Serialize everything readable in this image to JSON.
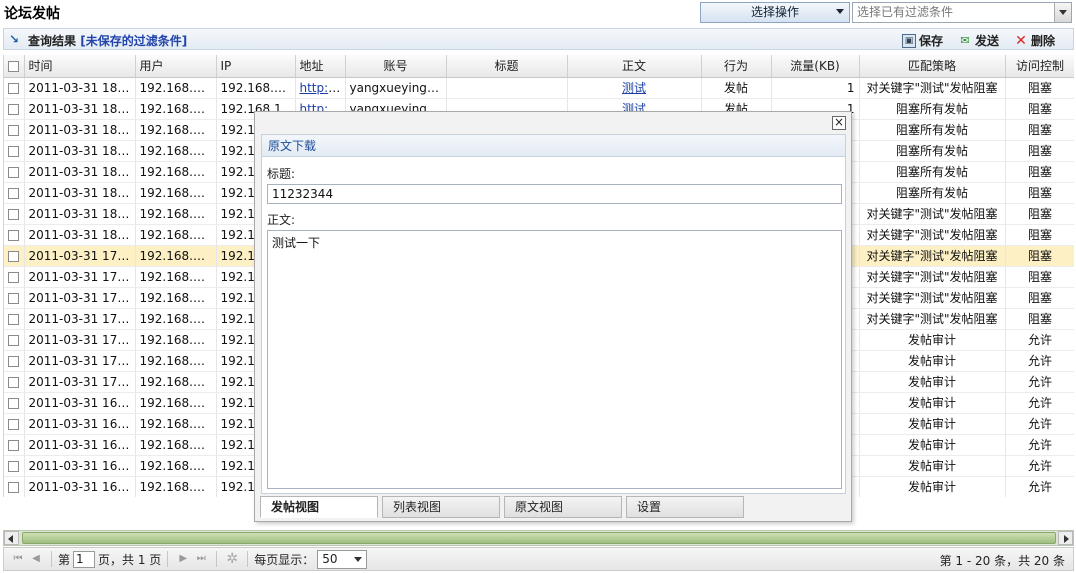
{
  "page_title": "论坛发帖",
  "toolbar": {
    "action_select": "选择操作",
    "filter_placeholder": "选择已有过滤条件"
  },
  "result_bar": {
    "label": "查询结果",
    "filter_name": "[未保存的过滤条件]",
    "save": "保存",
    "send": "发送",
    "delete": "删除"
  },
  "table": {
    "headers": [
      "时间",
      "用户",
      "IP",
      "地址",
      "账号",
      "标题",
      "正文",
      "行为",
      "流量(KB)",
      "匹配策略",
      "访问控制"
    ],
    "rows": [
      {
        "time": "2011-03-31 18:…",
        "user": "192.168.1…",
        "ip": "192.168.1…",
        "addr": "http:/…",
        "account": "yangxueying1…",
        "subject": "",
        "body": "测试",
        "action": "发帖",
        "traffic": "1",
        "policy": "对关键字\"测试\"发帖阻塞",
        "control": "阻塞"
      },
      {
        "time": "2011-03-31 18:…",
        "user": "192.168.1…",
        "ip": "192.168.1",
        "addr": "http:/…",
        "account": "yangxueying1…",
        "subject": "",
        "body": "测试",
        "action": "发帖",
        "traffic": "1",
        "policy": "阻塞所有发帖",
        "control": "阻塞"
      },
      {
        "time": "2011-03-31 18:…",
        "user": "192.168.1…",
        "ip": "192.168.1",
        "addr": "",
        "account": "",
        "subject": "",
        "body": "",
        "action": "",
        "traffic": "",
        "policy": "阻塞所有发帖",
        "control": "阻塞"
      },
      {
        "time": "2011-03-31 18:…",
        "user": "192.168.1…",
        "ip": "192.168",
        "addr": "",
        "account": "",
        "subject": "",
        "body": "",
        "action": "",
        "traffic": "",
        "policy": "阻塞所有发帖",
        "control": "阻塞"
      },
      {
        "time": "2011-03-31 18:…",
        "user": "192.168.1…",
        "ip": "192.16",
        "addr": "",
        "account": "",
        "subject": "",
        "body": "",
        "action": "",
        "traffic": "",
        "policy": "阻塞所有发帖",
        "control": "阻塞"
      },
      {
        "time": "2011-03-31 18:…",
        "user": "192.168.1…",
        "ip": "192.16",
        "addr": "",
        "account": "",
        "subject": "",
        "body": "",
        "action": "",
        "traffic": "",
        "policy": "阻塞所有发帖",
        "control": "阻塞"
      },
      {
        "time": "2011-03-31 18:…",
        "user": "192.168.1…",
        "ip": "192.16",
        "addr": "",
        "account": "",
        "subject": "",
        "body": "",
        "action": "",
        "traffic": "",
        "policy": "对关键字\"测试\"发帖阻塞",
        "control": "阻塞"
      },
      {
        "time": "2011-03-31 18:…",
        "user": "192.168.1…",
        "ip": "192.16",
        "addr": "",
        "account": "",
        "subject": "",
        "body": "",
        "action": "",
        "traffic": "",
        "policy": "对关键字\"测试\"发帖阻塞",
        "control": "阻塞"
      },
      {
        "time": "2011-03-31 17:…",
        "user": "192.168.1…",
        "ip": "192.16",
        "addr": "",
        "account": "",
        "subject": "",
        "body": "",
        "action": "",
        "traffic": "",
        "policy": "对关键字\"测试\"发帖阻塞",
        "control": "阻塞",
        "selected": true
      },
      {
        "time": "2011-03-31 17:…",
        "user": "192.168.1…",
        "ip": "192.16",
        "addr": "",
        "account": "",
        "subject": "",
        "body": "",
        "action": "",
        "traffic": "",
        "policy": "对关键字\"测试\"发帖阻塞",
        "control": "阻塞"
      },
      {
        "time": "2011-03-31 17:…",
        "user": "192.168.1…",
        "ip": "192.16",
        "addr": "",
        "account": "",
        "subject": "",
        "body": "",
        "action": "",
        "traffic": "",
        "policy": "对关键字\"测试\"发帖阻塞",
        "control": "阻塞"
      },
      {
        "time": "2011-03-31 17:…",
        "user": "192.168.1…",
        "ip": "192.16",
        "addr": "",
        "account": "",
        "subject": "",
        "body": "",
        "action": "",
        "traffic": "",
        "policy": "对关键字\"测试\"发帖阻塞",
        "control": "阻塞"
      },
      {
        "time": "2011-03-31 17:…",
        "user": "192.168.1…",
        "ip": "192.16",
        "addr": "",
        "account": "",
        "subject": "",
        "body": "",
        "action": "",
        "traffic": "",
        "policy": "发帖审计",
        "control": "允许"
      },
      {
        "time": "2011-03-31 17:…",
        "user": "192.168.1…",
        "ip": "192.16",
        "addr": "",
        "account": "",
        "subject": "",
        "body": "",
        "action": "",
        "traffic": "",
        "policy": "发帖审计",
        "control": "允许"
      },
      {
        "time": "2011-03-31 17:…",
        "user": "192.168.1…",
        "ip": "192.16",
        "addr": "",
        "account": "",
        "subject": "",
        "body": "",
        "action": "",
        "traffic": "",
        "policy": "发帖审计",
        "control": "允许"
      },
      {
        "time": "2011-03-31 16:…",
        "user": "192.168.1…",
        "ip": "192.16",
        "addr": "",
        "account": "",
        "subject": "",
        "body": "",
        "action": "",
        "traffic": "",
        "policy": "发帖审计",
        "control": "允许"
      },
      {
        "time": "2011-03-31 16:…",
        "user": "192.168.1…",
        "ip": "192.16",
        "addr": "",
        "account": "",
        "subject": "",
        "body": "",
        "action": "",
        "traffic": "",
        "policy": "发帖审计",
        "control": "允许"
      },
      {
        "time": "2011-03-31 16:…",
        "user": "192.168.1…",
        "ip": "192.16",
        "addr": "",
        "account": "",
        "subject": "",
        "body": "",
        "action": "",
        "traffic": "",
        "policy": "发帖审计",
        "control": "允许"
      },
      {
        "time": "2011-03-31 16:…",
        "user": "192.168.1…",
        "ip": "192.18",
        "addr": "",
        "account": "",
        "subject": "",
        "body": "",
        "action": "",
        "traffic": "",
        "policy": "发帖审计",
        "control": "允许"
      },
      {
        "time": "2011-03-31 16:…",
        "user": "192.168.1…",
        "ip": "192.18",
        "addr": "",
        "account": "",
        "subject": "",
        "body": "",
        "action": "",
        "traffic": "",
        "policy": "发帖审计",
        "control": "允许"
      }
    ]
  },
  "pager": {
    "page_prefix": "第",
    "page_value": "1",
    "page_suffix": "页，共 1 页",
    "per_page_label": "每页显示：",
    "per_page_value": "50",
    "info": "第 1 - 20 条，共 20 条"
  },
  "dialog": {
    "download_link": "原文下载",
    "subject_label": "标题:",
    "subject_value": "11232344",
    "body_label": "正文:",
    "body_value": "测试一下",
    "tabs": [
      "发帖视图",
      "列表视图",
      "原文视图",
      "设置"
    ],
    "active_tab": "发帖视图"
  }
}
